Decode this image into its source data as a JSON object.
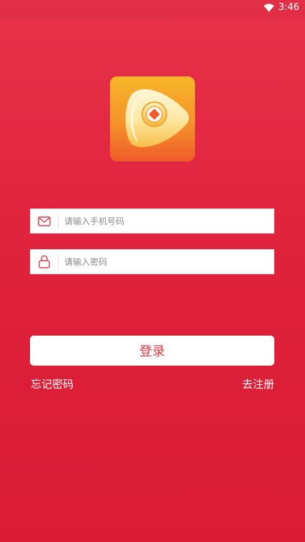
{
  "status_bar": {
    "time": "3:46",
    "wifi_icon": "wifi-icon"
  },
  "logo": {
    "icon": "play-coin-logo-icon"
  },
  "form": {
    "phone": {
      "icon": "mail-icon",
      "placeholder": "请输入手机号码",
      "value": ""
    },
    "password": {
      "icon": "lock-icon",
      "placeholder": "请输入密码",
      "value": ""
    },
    "login_label": "登录"
  },
  "links": {
    "forgot_password": "忘记密码",
    "register": "去注册"
  },
  "colors": {
    "background": "#e02a42",
    "accent": "#e23a45"
  }
}
